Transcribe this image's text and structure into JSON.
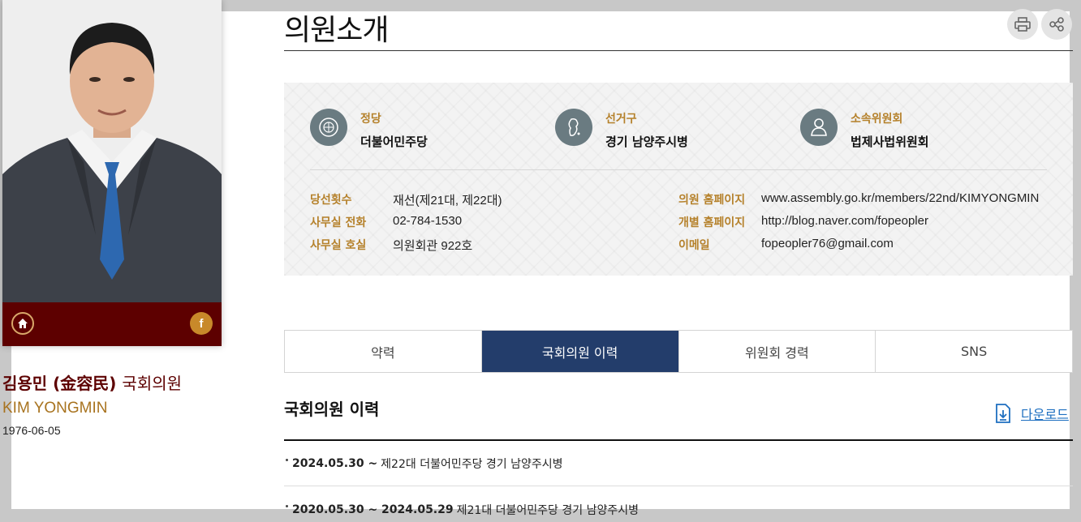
{
  "header": {
    "title": "의원소개",
    "print_icon": "printer-icon",
    "share_icon": "share-icon"
  },
  "profile": {
    "name_kr": "김용민 (金容民)",
    "name_title": "국회의원",
    "name_en": "KIM YONGMIN",
    "birth": "1976-06-05",
    "home_icon": "home-icon",
    "facebook_label": "f"
  },
  "summary": {
    "party": {
      "label": "정당",
      "value": "더불어민주당",
      "icon": "party-emblem-icon"
    },
    "district": {
      "label": "선거구",
      "value": "경기 남양주시병",
      "icon": "korea-map-icon"
    },
    "committee": {
      "label": "소속위원회",
      "value": "법제사법위원회",
      "icon": "person-icon"
    }
  },
  "details": {
    "terms": {
      "label": "당선횟수",
      "value": "재선(제21대, 제22대)"
    },
    "office_phone": {
      "label": "사무실 전화",
      "value": "02-784-1530"
    },
    "office_room": {
      "label": "사무실 호실",
      "value": "의원회관 922호"
    },
    "homepage": {
      "label": "의원 홈페이지",
      "value": "www.assembly.go.kr/members/22nd/KIMYONGMIN"
    },
    "personal_homepage": {
      "label": "개별 홈페이지",
      "value": "http://blog.naver.com/fopeopler"
    },
    "email": {
      "label": "이메일",
      "value": "fopeopler76@gmail.com"
    }
  },
  "tabs": [
    {
      "label": "약력",
      "active": false
    },
    {
      "label": "국회의원 이력",
      "active": true
    },
    {
      "label": "위원회 경력",
      "active": false
    },
    {
      "label": "SNS",
      "active": false
    }
  ],
  "history": {
    "title": "국회의원 이력",
    "download_label": "다운로드",
    "rows": [
      {
        "date": "2024.05.30 ~",
        "text": "제22대 더불어민주당 경기 남양주시병"
      },
      {
        "date": "2020.05.30 ~ 2024.05.29",
        "text": "제21대 더불어민주당 경기 남양주시병"
      }
    ]
  },
  "colors": {
    "accent_gold": "#b5812b",
    "maroon": "#5d0000",
    "tab_active": "#233d6b",
    "link_blue": "#1e6fc0"
  }
}
